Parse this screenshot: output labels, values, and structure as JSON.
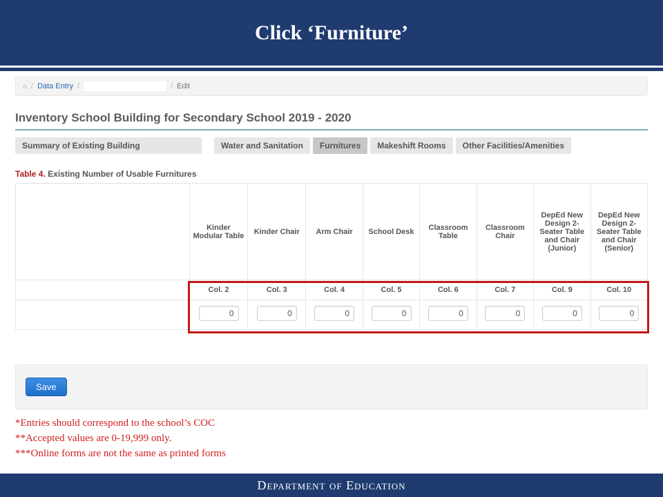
{
  "banner": {
    "title": "Click ‘Furniture’"
  },
  "breadcrumb": {
    "home_icon": "⌂",
    "data_entry": "Data Entry",
    "edit": "Edit",
    "sep": "/"
  },
  "page": {
    "title": "Inventory School Building for Secondary School 2019 - 2020"
  },
  "tabs": {
    "summary": "Summary of Existing Building",
    "water": "Water and Sanitation",
    "furnitures": "Furnitures",
    "makeshift": "Makeshift Rooms",
    "other": "Other Facilities/Amenities"
  },
  "table": {
    "caption_label": "Table 4.",
    "caption_text": "Existing Number of Usable Furnitures",
    "headers": [
      "Kinder Modular Table",
      "Kinder Chair",
      "Arm Chair",
      "School Desk",
      "Classroom Table",
      "Classroom Chair",
      "DepEd New Design 2-Seater Table and Chair (Junior)",
      "DepEd New Design 2-Seater Table and Chair (Senior)"
    ],
    "col_labels": [
      "Col. 2",
      "Col. 3",
      "Col. 4",
      "Col. 5",
      "Col. 6",
      "Col. 7",
      "Col. 9",
      "Col. 10"
    ],
    "values": [
      "0",
      "0",
      "0",
      "0",
      "0",
      "0",
      "0",
      "0"
    ]
  },
  "save": {
    "label": "Save"
  },
  "notes": {
    "n1": "*Entries should correspond to the school’s COC",
    "n2": "**Accepted values are 0-19,999 only.",
    "n3": "***Online forms are not the same as printed forms"
  },
  "footer": {
    "text": "Department of Education"
  }
}
